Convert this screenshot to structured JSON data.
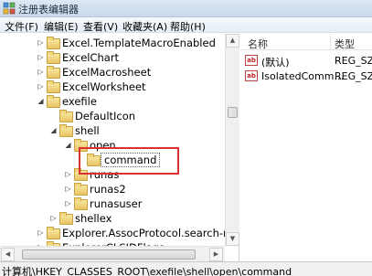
{
  "window": {
    "title": "注册表编辑器",
    "icon": "regedit-icon"
  },
  "menu": [
    "文件(F)",
    "编辑(E)",
    "查看(V)",
    "收藏夹(A)",
    "帮助(H)"
  ],
  "tree": [
    {
      "label": "Excel.TemplateMacroEnabled",
      "expander": "▷"
    },
    {
      "label": "ExcelChart",
      "expander": "▷"
    },
    {
      "label": "ExcelMacrosheet",
      "expander": "▷"
    },
    {
      "label": "ExcelWorksheet",
      "expander": "▷"
    },
    {
      "label": "exefile",
      "expander": "◢"
    },
    {
      "label": "DefaultIcon",
      "expander": ""
    },
    {
      "label": "shell",
      "expander": "◢"
    },
    {
      "label": "open",
      "expander": "◢"
    },
    {
      "label": "command",
      "expander": "",
      "selected": true
    },
    {
      "label": "runas",
      "expander": "▷"
    },
    {
      "label": "runas2",
      "expander": "▷"
    },
    {
      "label": "runasuser",
      "expander": "▷"
    },
    {
      "label": "shellex",
      "expander": "▷"
    },
    {
      "label": "Explorer.AssocProtocol.search-ms",
      "expander": "▷"
    },
    {
      "label": "ExplorerCLSIDFlags",
      "expander": "▷"
    }
  ],
  "list": {
    "headers": {
      "name": "名称",
      "type": "类型"
    },
    "rows": [
      {
        "name": "(默认)",
        "type": "REG_SZ",
        "icon": "string-value-icon"
      },
      {
        "name": "IsolatedComm…",
        "type": "REG_SZ",
        "icon": "string-value-icon"
      }
    ]
  },
  "status": "计算机\\HKEY_CLASSES_ROOT\\exefile\\shell\\open\\command",
  "colors": {
    "highlight": "#d93030",
    "titlebar": "#c9d8ec"
  }
}
